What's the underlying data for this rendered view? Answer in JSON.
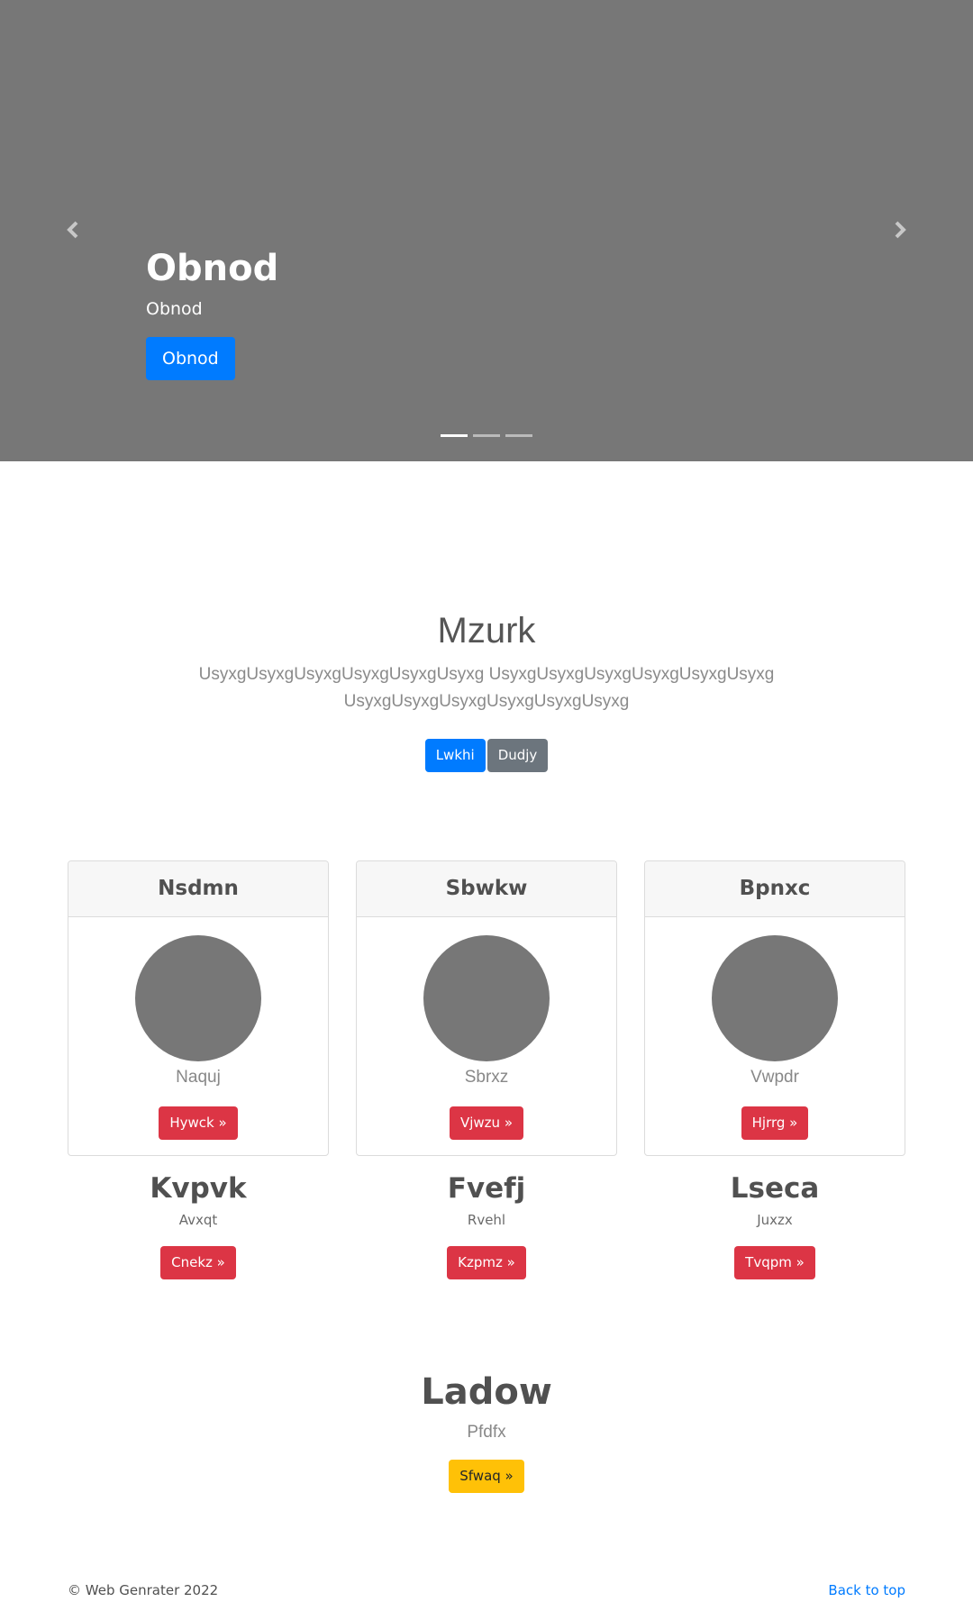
{
  "carousel": {
    "title": "Obnod",
    "subtitle": "Obnod",
    "button_label": "Obnod",
    "prev_icon": "chevron-left-icon",
    "next_icon": "chevron-right-icon",
    "slide_count": 3,
    "active_slide": 1
  },
  "jumbotron": {
    "title": "Mzurk",
    "lead": "UsyxgUsyxgUsyxgUsyxgUsyxgUsyxg UsyxgUsyxgUsyxgUsyxgUsyxgUsyxg UsyxgUsyxgUsyxgUsyxgUsyxgUsyxg",
    "primary_label": "Lwkhi",
    "secondary_label": "Dudjy"
  },
  "cards": [
    {
      "header": "Nsdmn",
      "text": "Naquj",
      "button": "Hywck »"
    },
    {
      "header": "Sbwkw",
      "text": "Sbrxz",
      "button": "Vjwzu »"
    },
    {
      "header": "Bpnxc",
      "text": "Vwpdr",
      "button": "Hjrrg »"
    }
  ],
  "columns": [
    {
      "title": "Kvpvk",
      "text": "Avxqt",
      "button": "Cnekz »"
    },
    {
      "title": "Fvefj",
      "text": "Rvehl",
      "button": "Kzpmz »"
    },
    {
      "title": "Lseca",
      "text": "Juxzx",
      "button": "Tvqpm »"
    }
  ],
  "feature": {
    "title": "Ladow",
    "text": "Pfdfx",
    "button": "Sfwaq »"
  },
  "footer": {
    "copyright": "© Web Genrater 2022",
    "back_to_top": "Back to top"
  },
  "colors": {
    "primary": "#007bff",
    "secondary": "#6c757d",
    "danger": "#dc3545",
    "warning": "#ffc107",
    "placeholder_gray": "#777777"
  }
}
